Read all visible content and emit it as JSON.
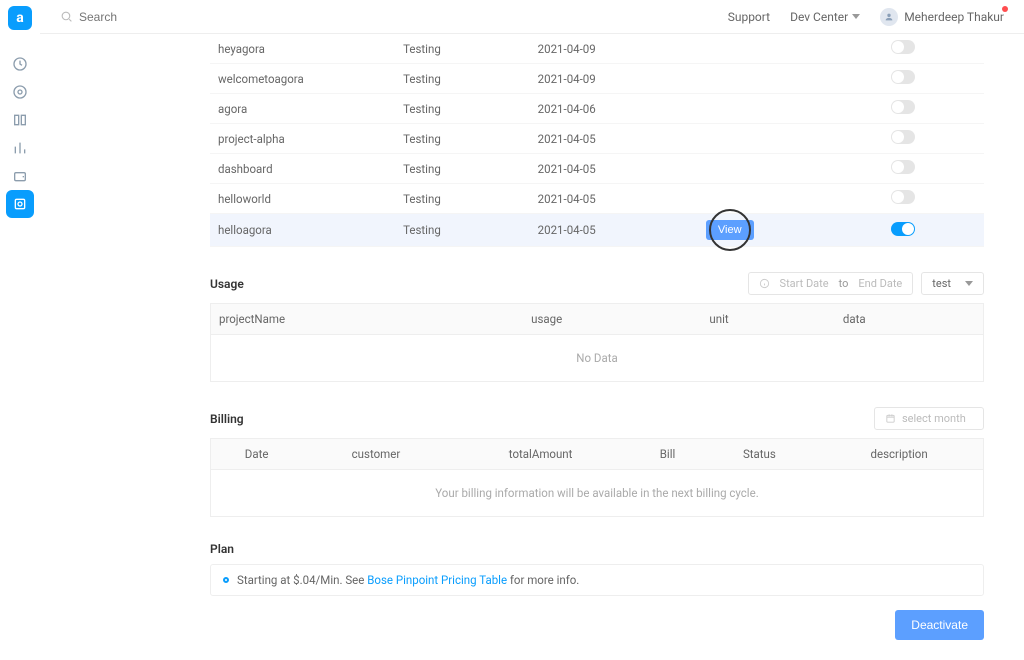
{
  "header": {
    "search_placeholder": "Search",
    "support_label": "Support",
    "dev_center_label": "Dev Center",
    "user_name": "Meherdeep Thakur"
  },
  "projects": [
    {
      "name": "heyagora",
      "stage": "Testing",
      "date": "2021-04-09",
      "enabled": false,
      "highlight": false
    },
    {
      "name": "welcometoagora",
      "stage": "Testing",
      "date": "2021-04-09",
      "enabled": false,
      "highlight": false
    },
    {
      "name": "agora",
      "stage": "Testing",
      "date": "2021-04-06",
      "enabled": false,
      "highlight": false
    },
    {
      "name": "project-alpha",
      "stage": "Testing",
      "date": "2021-04-05",
      "enabled": false,
      "highlight": false
    },
    {
      "name": "dashboard",
      "stage": "Testing",
      "date": "2021-04-05",
      "enabled": false,
      "highlight": false
    },
    {
      "name": "helloworld",
      "stage": "Testing",
      "date": "2021-04-05",
      "enabled": false,
      "highlight": false
    },
    {
      "name": "helloagora",
      "stage": "Testing",
      "date": "2021-04-05",
      "enabled": true,
      "highlight": true
    }
  ],
  "view_label": "View",
  "usage": {
    "title": "Usage",
    "start_placeholder": "Start Date",
    "to_label": "to",
    "end_placeholder": "End Date",
    "select_value": "test",
    "columns": [
      "projectName",
      "usage",
      "unit",
      "data"
    ],
    "empty_text": "No Data"
  },
  "billing": {
    "title": "Billing",
    "month_placeholder": "select month",
    "columns": [
      "Date",
      "customer",
      "totalAmount",
      "Bill",
      "Status",
      "description"
    ],
    "empty_text": "Your billing information will be available in the next billing cycle."
  },
  "plan": {
    "title": "Plan",
    "prefix": "Starting at $.04/Min. See ",
    "link_text": "Bose Pinpoint Pricing Table",
    "suffix": " for more info."
  },
  "deactivate_label": "Deactivate"
}
